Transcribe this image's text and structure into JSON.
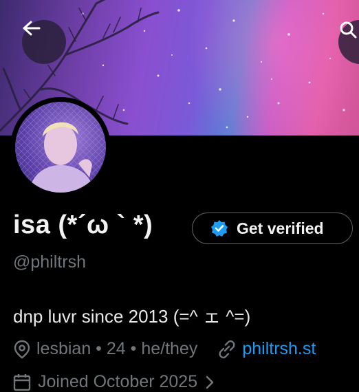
{
  "header": {
    "back_icon": "arrow-left-icon",
    "search_icon": "search-icon"
  },
  "profile": {
    "display_name": "isa (*´ω ` *)",
    "verify_label": "Get verified",
    "handle": "@philtrsh",
    "bio": "dnp luvr since 2013 (=^ ェ ^=)",
    "location": "lesbian • 24 • he/they",
    "website": "philtrsh.st",
    "joined": "Joined October 2025",
    "colors": {
      "accent": "#1d9bf0",
      "muted": "#71767b",
      "background": "#000000"
    }
  }
}
